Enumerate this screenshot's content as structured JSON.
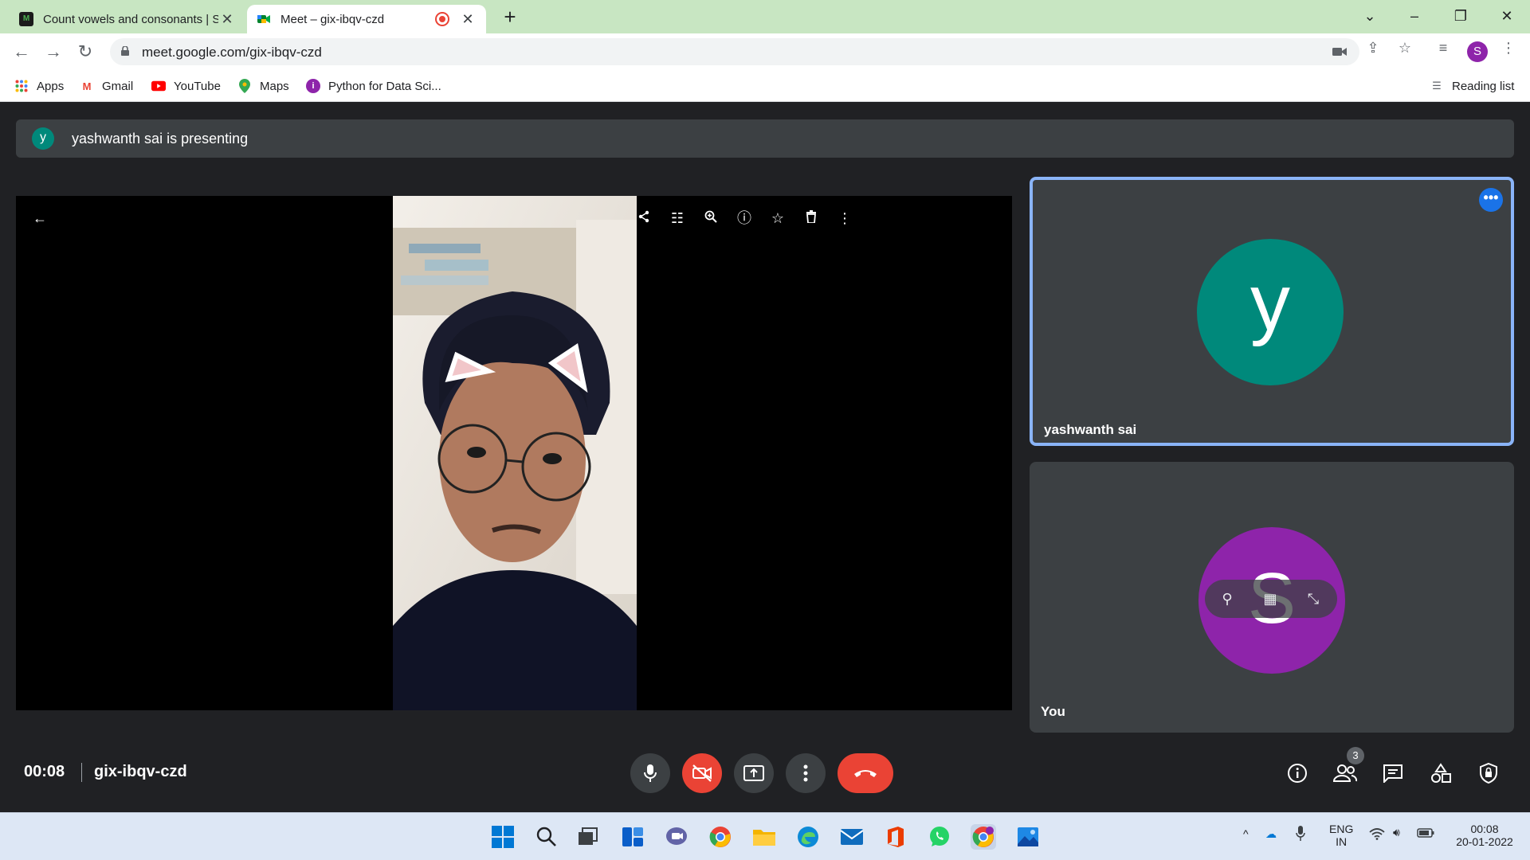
{
  "browser": {
    "tabs": [
      {
        "title": "Count vowels and consonants | S",
        "active": false
      },
      {
        "title": "Meet – gix-ibqv-czd",
        "active": true
      }
    ],
    "new_tab": "+",
    "url": "meet.google.com/gix-ibqv-czd",
    "profile_initial": "S",
    "bookmarks": [
      "Apps",
      "Gmail",
      "YouTube",
      "Maps",
      "Python for Data Sci..."
    ],
    "reading_list": "Reading list"
  },
  "meet": {
    "banner_initial": "y",
    "banner_text": "yashwanth sai is presenting",
    "tiles": [
      {
        "name": "yashwanth sai",
        "initial": "y",
        "color": "#00897b"
      },
      {
        "name": "You",
        "initial": "S",
        "color": "#8e24aa"
      }
    ],
    "time": "00:08",
    "meeting_code": "gix-ibqv-czd",
    "participants_count": "3"
  },
  "taskbar": {
    "language": "ENG",
    "region": "IN",
    "clock_time": "00:08",
    "clock_date": "20-01-2022"
  }
}
